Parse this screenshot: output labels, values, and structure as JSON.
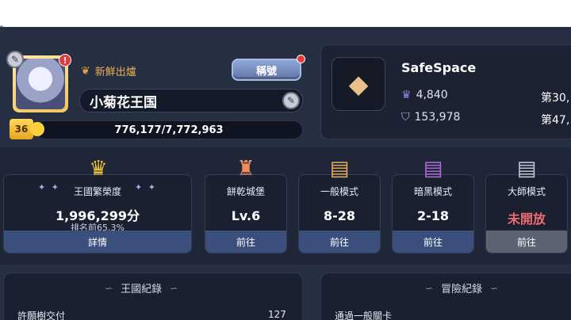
{
  "profile": {
    "title_tag": "新鮮出爐",
    "title_button": "稱號",
    "name": "小菊花王国",
    "level": "36",
    "xp": "776,177/7,772,963",
    "alert": "!"
  },
  "guild": {
    "name": "SafeSpace",
    "stat1_value": "4,840",
    "stat1_rank": "第30,",
    "stat2_value": "153,978",
    "stat2_rank": "第47,"
  },
  "cards": [
    {
      "title": "王國繁榮度",
      "value": "1,996,299分",
      "sub": "排名前65.3%",
      "foot": "詳情"
    },
    {
      "title": "餅乾城堡",
      "value": "Lv.6",
      "foot": "前往"
    },
    {
      "title": "一般模式",
      "value": "8-28",
      "foot": "前往"
    },
    {
      "title": "暗黑模式",
      "value": "2-18",
      "foot": "前往"
    },
    {
      "title": "大師模式",
      "value": "未開放",
      "foot": "前往"
    }
  ],
  "panels": {
    "kingdom_title": "王國紀錄",
    "kingdom_row_label": "許願樹交付",
    "kingdom_row_value": "127",
    "adventure_title": "冒險紀錄",
    "adventure_row_label": "通過一般關卡"
  },
  "icons": {
    "avatar": "cookie-avatar",
    "guild_emblem": "diamond-emblem",
    "level": "crown-level"
  },
  "colors": {
    "accent_button": "#5f76a8",
    "locked_red": "#f06a72",
    "title_gold": "#e9b055"
  }
}
